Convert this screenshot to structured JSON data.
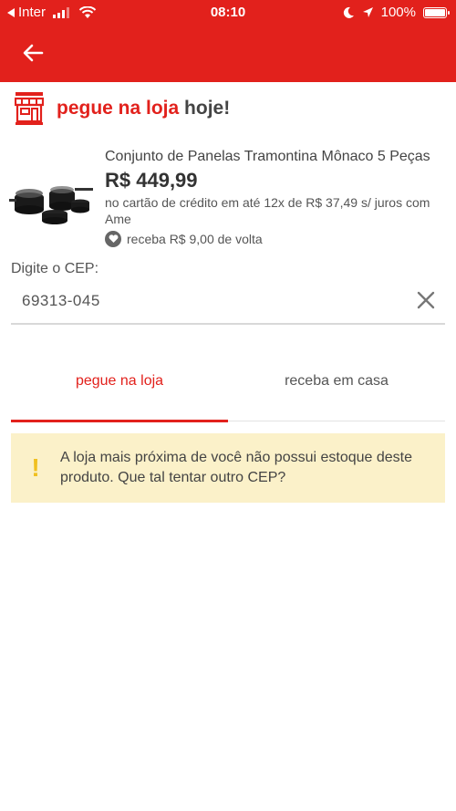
{
  "status_bar": {
    "carrier": "Inter",
    "time": "08:10",
    "battery": "100%"
  },
  "header": {
    "back_icon": "arrow-left-icon",
    "title_accent": "pegue na loja",
    "title_rest": "hoje!"
  },
  "product": {
    "name": "Conjunto de Panelas Tramontina Mônaco 5 Peças",
    "price": "R$ 449,99",
    "installments": "no cartão de crédito em até 12x de R$ 37,49 s/ juros com Ame",
    "cashback": "receba R$ 9,00 de volta"
  },
  "cep": {
    "label": "Digite o CEP:",
    "value": "69313-045"
  },
  "tabs": [
    {
      "label": "pegue na loja",
      "active": true
    },
    {
      "label": "receba em casa",
      "active": false
    }
  ],
  "alert": {
    "icon": "!",
    "line1": "A loja mais próxima de você não possui estoque deste",
    "line2": "produto. Que tal tentar outro CEP?"
  },
  "colors": {
    "brand_red": "#e2211c",
    "alert_bg": "#fbf1c9",
    "alert_icon": "#f0c020"
  }
}
